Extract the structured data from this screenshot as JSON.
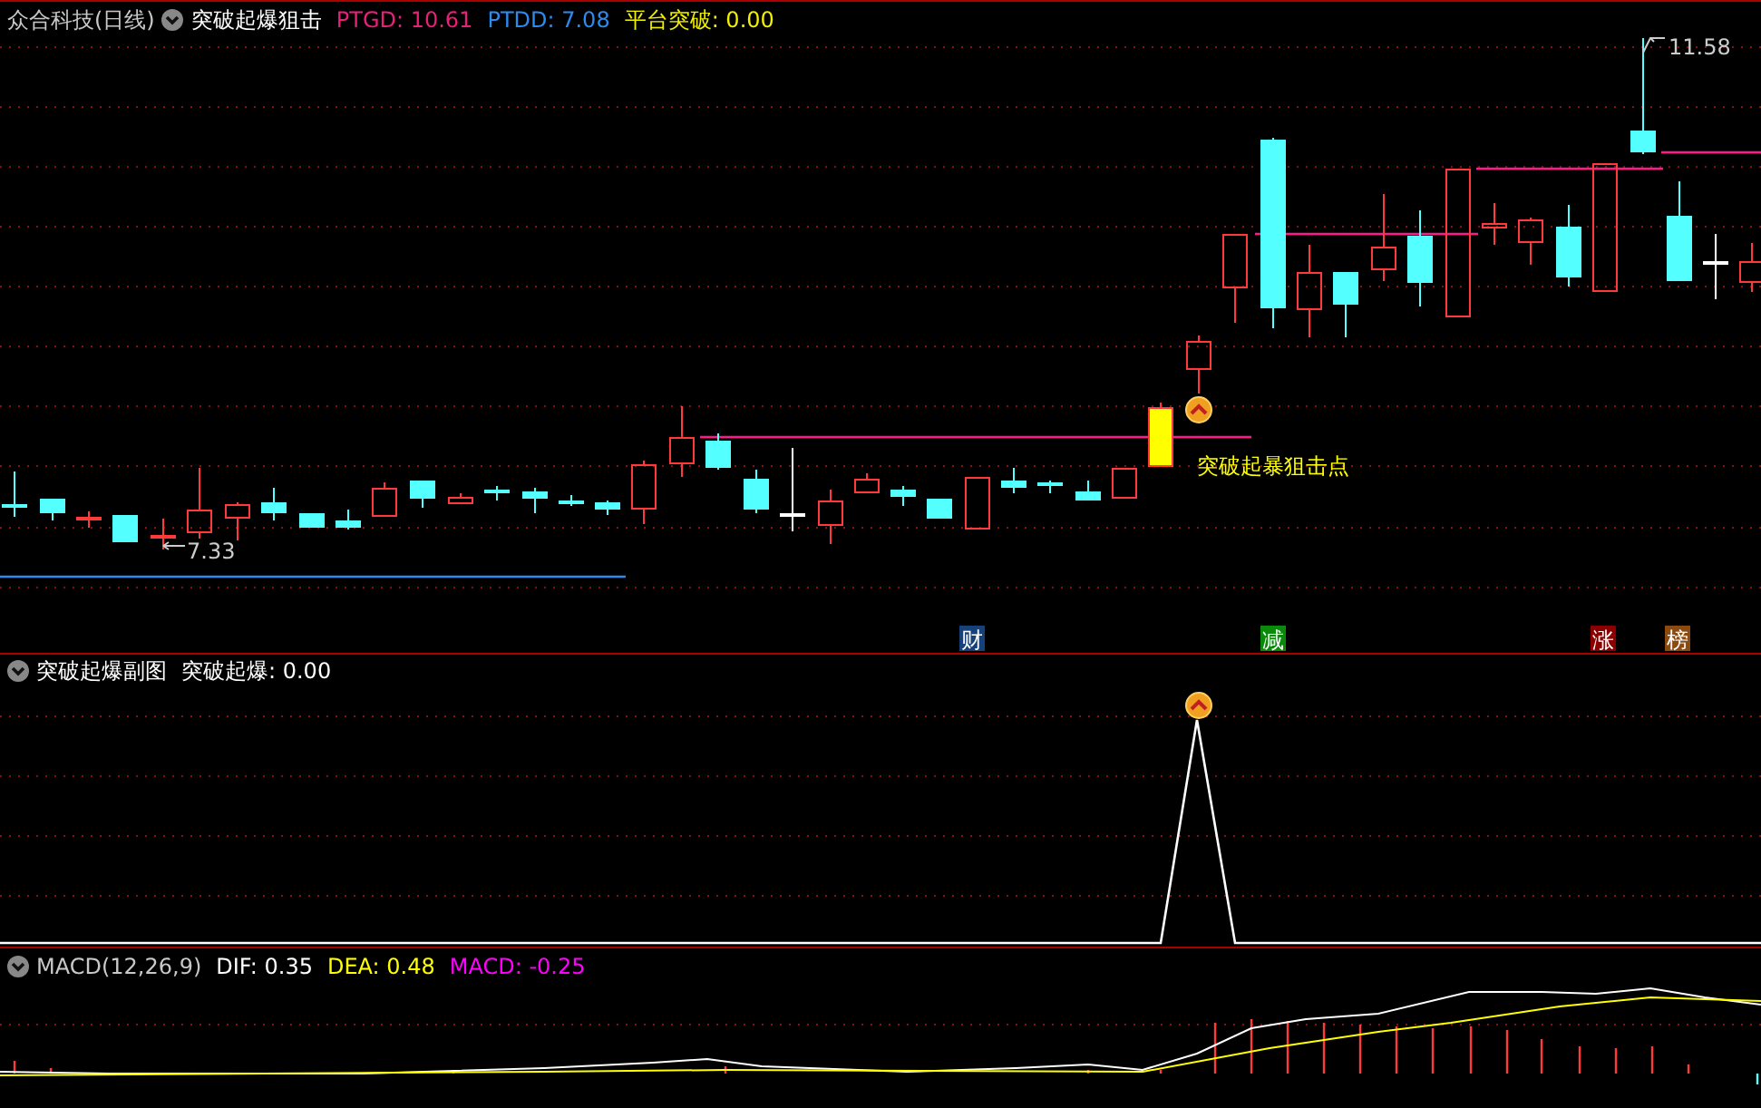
{
  "main_panel": {
    "title": "众合科技(日线)",
    "indicator": "突破起爆狙击",
    "legend": [
      {
        "label": "PTGD: 10.61",
        "color": "#e8207a"
      },
      {
        "label": "PTDD: 7.08",
        "color": "#2a8cf0"
      },
      {
        "label": "平台突破: 0.00",
        "color": "#f0f000"
      }
    ],
    "high_label": "11.58",
    "low_label": "7.33",
    "signal_label": "突破起暴狙击点",
    "markers": [
      {
        "label": "财",
        "color": "#17417a"
      },
      {
        "label": "减",
        "color": "#0a8a0a"
      },
      {
        "label": "涨",
        "color": "#8a0000"
      },
      {
        "label": "榜",
        "color": "#8a4a10"
      }
    ]
  },
  "sub_panel": {
    "title": "突破起爆副图",
    "legend": [
      {
        "label": "突破起爆: 0.00",
        "color": "#ffffff"
      }
    ]
  },
  "macd_panel": {
    "title": "MACD(12,26,9)",
    "legend": [
      {
        "label": "DIF: 0.35",
        "color": "#ffffff"
      },
      {
        "label": "DEA: 0.48",
        "color": "#ffff00"
      },
      {
        "label": "MACD: -0.25",
        "color": "#ff00ff"
      }
    ]
  }
}
